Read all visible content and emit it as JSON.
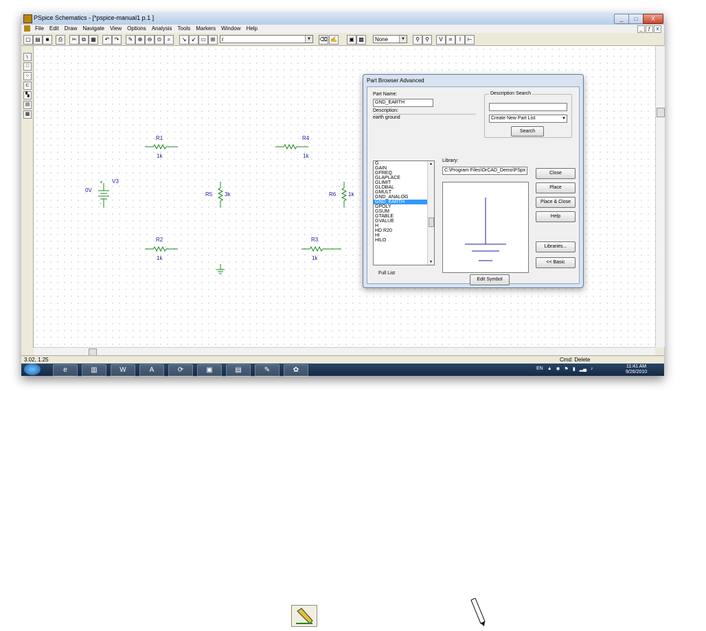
{
  "window": {
    "title": "PSpice Schematics - [*pspice-manual1  p.1  ]",
    "minimize": "_",
    "maximize": "□",
    "close": "X"
  },
  "menubar": {
    "items": [
      "File",
      "Edit",
      "Draw",
      "Navigate",
      "View",
      "Options",
      "Analysis",
      "Tools",
      "Markers",
      "Window",
      "Help"
    ],
    "mdi": [
      "_",
      "ƒ",
      "x"
    ]
  },
  "toolbar": {
    "part_combo": "r",
    "marker_combo": "None"
  },
  "schematic": {
    "parts": [
      {
        "name": "R1",
        "value": "1k"
      },
      {
        "name": "R4",
        "value": "1k"
      },
      {
        "name": "R2",
        "value": "1k"
      },
      {
        "name": "R3",
        "value": "1k"
      },
      {
        "name": "R5",
        "value": "3k"
      },
      {
        "name": "R6",
        "value": "1k"
      },
      {
        "name": "V3",
        "value": "0V"
      }
    ],
    "battery_plus": "+",
    "battery_minus": "-"
  },
  "dialog": {
    "title": "Part Browser Advanced",
    "part_name_label": "Part Name:",
    "part_name_value": "GND_EARTH",
    "description_label": "Description:",
    "description_value": "earth ground",
    "desc_search_label": "Description Search",
    "search_text": "",
    "create_list_option": "Create New Part List",
    "search_button": "Search",
    "library_label": "Library:",
    "library_path": "C:\\Program Files\\OrCAD_Demo\\PSpx",
    "parts_list": [
      "G",
      "GAIN",
      "GFREQ",
      "GLAPLACE",
      "GLIMIT",
      "GLOBAL",
      "GMULT",
      "GND_ANALOG",
      "GND_EARTH",
      "GPOLY",
      "GSUM",
      "GTABLE",
      "GVALUE",
      "H",
      "HD R20",
      "HI",
      "HILO"
    ],
    "selected_part": "GND_EARTH",
    "full_list_label": "Full List",
    "buttons": {
      "close": "Close",
      "place": "Place",
      "place_close": "Place & Close",
      "help": "Help",
      "libraries": "Libraries...",
      "basic": "<< Basic",
      "edit_symbol": "Edit Symbol"
    }
  },
  "status": {
    "coords": "3.02,  1.25",
    "cmd": "Cmd: Delete"
  },
  "taskbar": {
    "tray": {
      "lang": "EN"
    },
    "clock": {
      "time": "11:41 AM",
      "date": "9/26/2010"
    }
  },
  "colors": {
    "schematic_wire": "#1a8a1a",
    "label_blue": "#1a1aa8",
    "selection": "#3399ff"
  }
}
